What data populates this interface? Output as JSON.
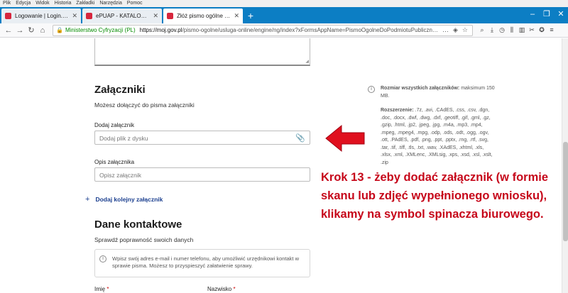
{
  "menu": [
    "Plik",
    "Edycja",
    "Widok",
    "Historia",
    "Zakładki",
    "Narzędzia",
    "Pomoc"
  ],
  "tabs": [
    {
      "title": "Logowanie | Login.gov.pl",
      "color": "#d7263d"
    },
    {
      "title": "ePUAP - KATALOG SPRAW",
      "color": "#d7263d"
    },
    {
      "title": "Złóż pismo ogólne do podmiotu publicznego",
      "color": "#d7263d"
    }
  ],
  "window_controls": [
    "–",
    "❐",
    "✕"
  ],
  "address_bar": {
    "identity": "Ministerstwo Cyfryzacji (PL)",
    "url_host": "https://moj.gov.pl",
    "url_path": "/pismo-ogolne/usluga-online/engine/ng/index?xFormsAppName=PismoOgolneDoPodmiotuPublicznego&xFormsFormName..."
  },
  "attachments": {
    "heading": "Załączniki",
    "subtext": "Możesz dołączyć do pisma załączniki",
    "file_label": "Dodaj załącznik",
    "file_placeholder": "Dodaj plik z dysku",
    "desc_label": "Opis załącznika",
    "desc_placeholder": "Opisz załącznik",
    "add_more": "Dodaj kolejny załącznik",
    "max_size_label": "Rozmiar wszystkich załączników:",
    "max_size_value": "maksimum 150 MB.",
    "ext_label": "Rozszerzenie:",
    "ext_value": ".7z, .avi, .CAdES, .css, .csv, .dgn, .doc, .docx, .dwf, .dwg, .dxf, .geotiff, .gif, .gml, .gz, .gzip, .html, .jp2, .jpeg, .jpg, .m4a, .mp3, .mp4, .mpeg, .mpeg4, .mpg, .odp, .ods, .odt, .ogg, .ogv, .ott, .PAdES, .pdf, .png, .ppt, .pptx, .rng, .rtf, .svg, .tar, .tif, .tiff, .tls, .txt, .wav, .XAdES, .xhtml, .xls, .xlsx, .xml, .XMLenc, .XMLsig, .xps, .xsd, .xsl, .xslt, .zip"
  },
  "contact": {
    "heading": "Dane kontaktowe",
    "subtext": "Sprawdź poprawność swoich danych",
    "info": "Wpisz swój adres e-mail i numer telefonu, aby umożliwić urzędnikowi kontakt w sprawie pisma. Możesz to przyspieszyć załatwienie sprawy.",
    "first_name_label": "Imię",
    "last_name_label": "Nazwisko"
  },
  "annotation": "Krok 13 - żeby dodać załącznik (w formie skanu lub zdjęć wypełnionego wniosku), klikamy na symbol spinacza biurowego.",
  "colors": {
    "annotation": "#c6071a",
    "tabbar": "#0c7ec4",
    "link": "#1b3f8f"
  }
}
